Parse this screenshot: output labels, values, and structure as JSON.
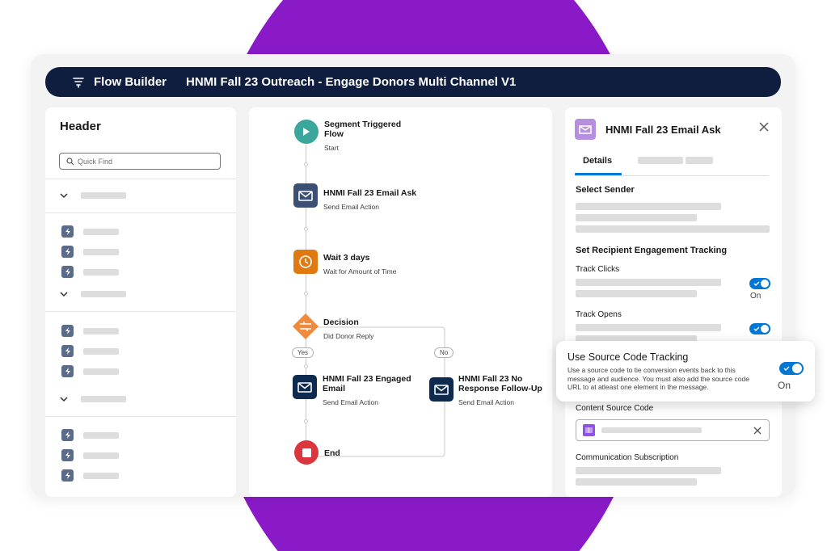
{
  "header": {
    "app_name": "Flow Builder",
    "flow_title": "HNMI Fall 23 Outreach - Engage Donors Multi Channel V1"
  },
  "left_panel": {
    "title": "Header",
    "search_placeholder": "Quick Find"
  },
  "flow": {
    "nodes": [
      {
        "title": "Segment Triggered Flow",
        "subtitle": "Start",
        "icon": "play-icon",
        "color": "#3ba79c"
      },
      {
        "title": "HNMI Fall 23 Email Ask",
        "subtitle": "Send Email Action",
        "icon": "email-icon",
        "color": "#3c4f75"
      },
      {
        "title": "Wait 3 days",
        "subtitle": "Wait for Amount of Time",
        "icon": "clock-icon",
        "color": "#e07a10"
      },
      {
        "title": "Decision",
        "subtitle": "Did Donor Reply",
        "icon": "decision-icon",
        "color": "#f08a3c"
      },
      {
        "title": "HNMI Fall 23 Engaged Email",
        "subtitle": "Send Email Action",
        "icon": "email-icon",
        "color": "#0f2a4f"
      },
      {
        "title": "HNMI Fall 23 No Response Follow-Up",
        "subtitle": "Send Email Action",
        "icon": "email-icon",
        "color": "#0f2a4f"
      },
      {
        "title": "End",
        "subtitle": "",
        "icon": "stop-icon",
        "color": "#d9363e"
      }
    ],
    "branch_yes": "Yes",
    "branch_no": "No"
  },
  "right_panel": {
    "title": "HNMI Fall 23 Email Ask",
    "tab_details": "Details",
    "select_sender": "Select Sender",
    "engagement_heading": "Set Recipient Engagement Tracking",
    "track_clicks": "Track Clicks",
    "track_opens": "Track Opens",
    "toggle_on_label": "On",
    "content_source_code": "Content Source Code",
    "communication_subscription": "Communication Subscription"
  },
  "popover": {
    "title": "Use Source Code Tracking",
    "body": "Use a source code to tie conversion events back to this message and audience. You must also add the source code URL to at atleast one element in the message.",
    "toggle_label": "On"
  },
  "colors": {
    "accent_purple": "#8a1ac8",
    "nav_bar": "#0f1d3e",
    "toggle_blue": "#0176d3"
  }
}
